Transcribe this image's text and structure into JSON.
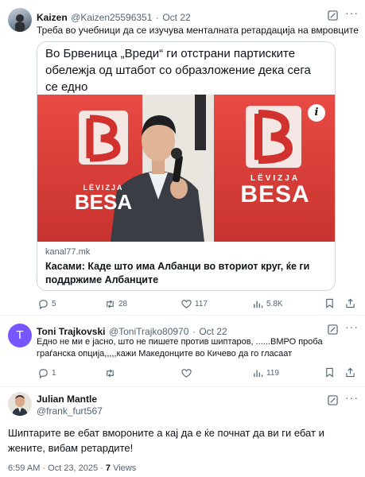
{
  "tweet1": {
    "name": "Kaizen",
    "handle": "@Kaizen25596351",
    "dot": "·",
    "date": "Oct 22",
    "text": "Треба во учебници да се изучува менталната ретардација на вмровците",
    "card": {
      "headline": "Во Брвеница „Вреди“ ги отстрани партиските обележја од штабот со образложение дека  сега се едно",
      "logo_text": "LËVIZJA",
      "logo_brand": "BESA",
      "domain": "kanal77.mk",
      "title": "Касами: Каде што има Албанци во вториот круг, ќе ги поддржиме Албанците",
      "info": "i"
    },
    "actions": {
      "replies": "5",
      "reposts": "28",
      "likes": "117",
      "views": "5.8K"
    }
  },
  "tweet2": {
    "avatar_letter": "T",
    "name": "Toni Trajkovski",
    "handle": "@ToniTrajko80970",
    "dot": "·",
    "date": "Oct 22",
    "text": "Едно не ми е јасно, што не пишете против шиптаров, ......ВМРО проба граѓанска опција,,,,,кажи Македонците во Кичево да го гласаат",
    "actions": {
      "replies": "1",
      "reposts": "",
      "likes": "",
      "views": "119"
    }
  },
  "tweet3": {
    "name": "Julian Mantle",
    "handle": "@frank_furt567",
    "text": "Шиптарите ве ебат вмороните а кај да е ќе почнат да ви ги ебат и жените, вибам ретардите!",
    "meta_time": "6:59 AM · Oct 23, 2025 · ",
    "views_count": "7",
    "views_label": " Views"
  },
  "colors": {
    "text": "#0f1419",
    "muted": "#536471",
    "border": "#cfd9de",
    "besa_red": "#e23a36",
    "avatar_purple": "#7856ff"
  },
  "icons": [
    "reply-icon",
    "repost-icon",
    "like-icon",
    "views-icon",
    "bookmark-icon",
    "share-icon",
    "grok-icon",
    "more-icon",
    "info-icon"
  ]
}
